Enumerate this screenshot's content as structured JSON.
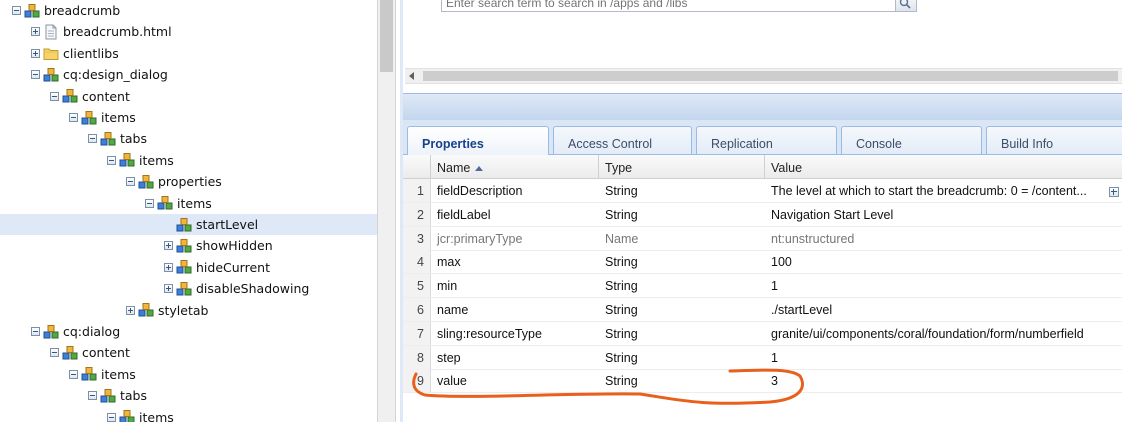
{
  "tree": {
    "nodes": [
      {
        "label": "breadcrumb",
        "icon": "node-icon",
        "toggle": "minus"
      },
      {
        "label": "breadcrumb.html",
        "icon": "file-icon",
        "toggle": "plus"
      },
      {
        "label": "clientlibs",
        "icon": "folder-icon",
        "toggle": "plus"
      },
      {
        "label": "cq:design_dialog",
        "icon": "node-icon",
        "toggle": "minus"
      },
      {
        "label": "content",
        "icon": "node-icon",
        "toggle": "minus"
      },
      {
        "label": "items",
        "icon": "node-icon",
        "toggle": "minus"
      },
      {
        "label": "tabs",
        "icon": "node-icon",
        "toggle": "minus"
      },
      {
        "label": "items",
        "icon": "node-icon",
        "toggle": "minus"
      },
      {
        "label": "properties",
        "icon": "node-icon",
        "toggle": "minus"
      },
      {
        "label": "items",
        "icon": "node-icon",
        "toggle": "minus"
      },
      {
        "label": "startLevel",
        "icon": "node-icon",
        "toggle": "none",
        "selected": true
      },
      {
        "label": "showHidden",
        "icon": "node-icon",
        "toggle": "plus"
      },
      {
        "label": "hideCurrent",
        "icon": "node-icon",
        "toggle": "plus"
      },
      {
        "label": "disableShadowing",
        "icon": "node-icon",
        "toggle": "plus"
      },
      {
        "label": "styletab",
        "icon": "node-icon",
        "toggle": "plus"
      },
      {
        "label": "cq:dialog",
        "icon": "node-icon",
        "toggle": "minus"
      },
      {
        "label": "content",
        "icon": "node-icon",
        "toggle": "minus"
      },
      {
        "label": "items",
        "icon": "node-icon",
        "toggle": "minus"
      },
      {
        "label": "tabs",
        "icon": "node-icon",
        "toggle": "minus"
      },
      {
        "label": "items",
        "icon": "node-icon",
        "toggle": "minus"
      }
    ]
  },
  "search": {
    "placeholder": "Enter search term to search in /apps and /libs"
  },
  "tabs": [
    "Properties",
    "Access Control",
    "Replication",
    "Console",
    "Build Info"
  ],
  "active_tab": "Properties",
  "grid": {
    "columns": {
      "name": "Name",
      "type": "Type",
      "value": "Value"
    },
    "rows": [
      {
        "num": "1",
        "name": "fieldDescription",
        "type": "String",
        "value": "The level at which to start the breadcrumb: 0 = /content..."
      },
      {
        "num": "2",
        "name": "fieldLabel",
        "type": "String",
        "value": "Navigation Start Level"
      },
      {
        "num": "3",
        "name": "jcr:primaryType",
        "type": "Name",
        "value": "nt:unstructured",
        "muted": true
      },
      {
        "num": "4",
        "name": "max",
        "type": "String",
        "value": "100"
      },
      {
        "num": "5",
        "name": "min",
        "type": "String",
        "value": "1"
      },
      {
        "num": "6",
        "name": "name",
        "type": "String",
        "value": "./startLevel"
      },
      {
        "num": "7",
        "name": "sling:resourceType",
        "type": "String",
        "value": "granite/ui/components/coral/foundation/form/numberfield"
      },
      {
        "num": "8",
        "name": "step",
        "type": "String",
        "value": "1"
      },
      {
        "num": "9",
        "name": "value",
        "type": "String",
        "value": "3",
        "highlighted": true
      }
    ]
  },
  "colors": {
    "selection": "#dfe8f6",
    "tab_active_text": "#15428b",
    "annotation": "#e8601c"
  }
}
